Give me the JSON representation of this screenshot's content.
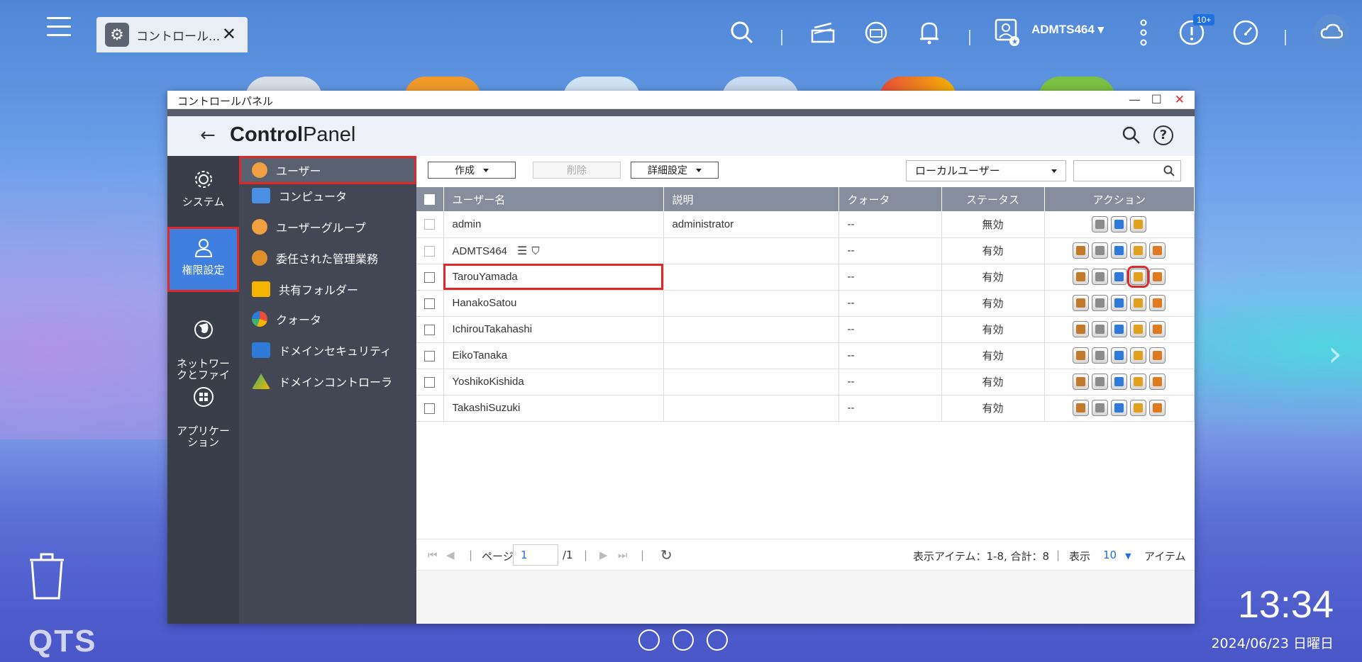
{
  "topbar": {
    "tab_label": "コントロール...",
    "user": "ADMTS464",
    "notif_badge": "10+"
  },
  "window": {
    "title": "コントロールパネル",
    "header_bold": "Control",
    "header_light": "Panel"
  },
  "rail": [
    {
      "label": "システム",
      "icon": "gear-icon"
    },
    {
      "label": "権限設定",
      "icon": "user-icon"
    },
    {
      "label": "ネットワー\nクとファイ",
      "icon": "globe-icon"
    },
    {
      "label": "アプリケー\nション",
      "icon": "apps-icon"
    }
  ],
  "submenu": [
    {
      "label": "ユーザー",
      "icon": "user-icon",
      "color": "#f0a040"
    },
    {
      "label": "コンピュータ",
      "icon": "computer-icon",
      "color": "#4a90e2"
    },
    {
      "label": "ユーザーグループ",
      "icon": "user-group-icon",
      "color": "#f0a040"
    },
    {
      "label": "委任された管理業務",
      "icon": "delegate-icon",
      "color": "#e08f2a"
    },
    {
      "label": "共有フォルダー",
      "icon": "folder-icon",
      "color": "#f4b400"
    },
    {
      "label": "クォータ",
      "icon": "quota-icon",
      "color": "#e74c3c"
    },
    {
      "label": "ドメインセキュリティ",
      "icon": "domain-security-icon",
      "color": "#2f7ad8"
    },
    {
      "label": "ドメインコントローラ",
      "icon": "domain-controller-icon",
      "color": "#3cb371"
    }
  ],
  "toolbar": {
    "create": "作成",
    "delete": "削除",
    "advanced": "詳細設定",
    "filter": "ローカルユーザー"
  },
  "table": {
    "headers": [
      "ユーザー名",
      "説明",
      "クォータ",
      "ステータス",
      "アクション"
    ],
    "rows": [
      {
        "name": "admin",
        "desc": "administrator",
        "quota": "--",
        "status": "無効",
        "status_type": "off",
        "actions": 3
      },
      {
        "name": "ADMTS464",
        "desc": "",
        "quota": "--",
        "status": "有効",
        "status_type": "on",
        "actions": 5
      },
      {
        "name": "TarouYamada",
        "desc": "",
        "quota": "--",
        "status": "有効",
        "status_type": "on",
        "actions": 5
      },
      {
        "name": "HanakoSatou",
        "desc": "",
        "quota": "--",
        "status": "有効",
        "status_type": "on",
        "actions": 5
      },
      {
        "name": "IchirouTakahashi",
        "desc": "",
        "quota": "--",
        "status": "有効",
        "status_type": "on",
        "actions": 5
      },
      {
        "name": "EikoTanaka",
        "desc": "",
        "quota": "--",
        "status": "有効",
        "status_type": "on",
        "actions": 5
      },
      {
        "name": "YoshikoKishida",
        "desc": "",
        "quota": "--",
        "status": "有効",
        "status_type": "on",
        "actions": 5
      },
      {
        "name": "TakashiSuzuki",
        "desc": "",
        "quota": "--",
        "status": "有効",
        "status_type": "on",
        "actions": 5
      }
    ]
  },
  "pager": {
    "page_label": "ページ",
    "page_value": "1",
    "page_total": "/1",
    "summary": "表示アイテム：1-8, 合計：8",
    "show_label": "表示",
    "per_page": "10",
    "items_label": "アイテム"
  },
  "desktop": {
    "brand": "QTS",
    "time": "13:34",
    "date": "2024/06/23 日曜日"
  }
}
